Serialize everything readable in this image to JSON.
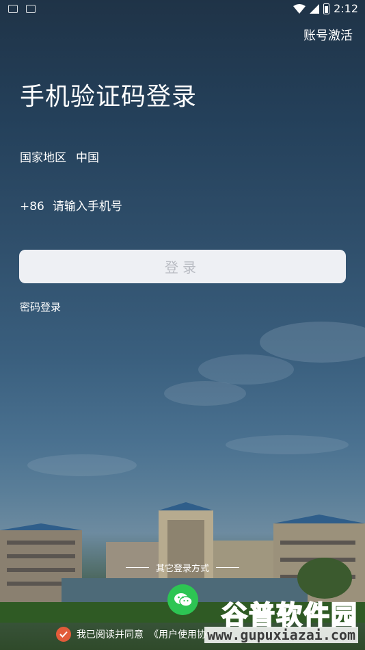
{
  "status_bar": {
    "time": "2:12"
  },
  "header": {
    "activate_label": "账号激活"
  },
  "main": {
    "title": "手机验证码登录",
    "region_label": "国家地区",
    "region_value": "中国",
    "country_code": "+86",
    "phone_placeholder": "请输入手机号",
    "login_button": "登录",
    "password_login": "密码登录"
  },
  "footer": {
    "other_methods": "其它登录方式",
    "agreement_prefix": "我已阅读并同意",
    "agreement_link": "《用户使用协"
  },
  "watermark": {
    "cn": "谷普软件园",
    "en": "www.gupuxiazai.com"
  },
  "colors": {
    "accent_green": "#2dc553",
    "check_red": "#e25b3a",
    "button_bg": "#eef0f4"
  }
}
